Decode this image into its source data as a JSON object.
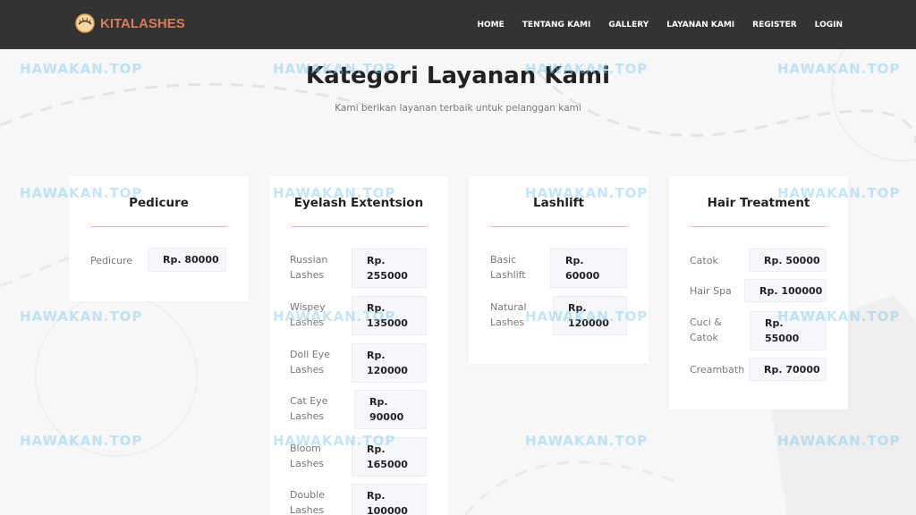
{
  "brand": {
    "name": "KITALASHES"
  },
  "nav": {
    "items": [
      "HOME",
      "TENTANG KAMI",
      "GALLERY",
      "LAYANAN KAMI",
      "REGISTER",
      "LOGIN"
    ]
  },
  "header": {
    "title": "Kategori Layanan Kami",
    "subtitle": "Kami berikan layanan terbaik untuk pelanggan kami"
  },
  "categories": [
    {
      "title": "Pedicure",
      "services": [
        {
          "name": "Pedicure",
          "price": "Rp. 80000"
        }
      ]
    },
    {
      "title": "Eyelash Extentsion",
      "services": [
        {
          "name1": "Russian",
          "name2": "Lashes",
          "price1": "Rp.",
          "price2": "255000"
        },
        {
          "name1": "Wispey",
          "name2": "Lashes",
          "price1": "Rp.",
          "price2": "135000"
        },
        {
          "name1": "Doll Eye",
          "name2": "Lashes",
          "price1": "Rp.",
          "price2": "120000"
        },
        {
          "name1": "Cat Eye",
          "name2": "Lashes",
          "price1": "Rp.",
          "price2": "90000"
        },
        {
          "name1": "Bloom",
          "name2": "Lashes",
          "price1": "Rp.",
          "price2": "165000"
        },
        {
          "name1": "Double",
          "name2": "Lashes",
          "price1": "Rp.",
          "price2": "100000"
        }
      ]
    },
    {
      "title": "Lashlift",
      "services": [
        {
          "name1": "Basic",
          "name2": "Lashlift",
          "price1": "Rp.",
          "price2": "60000"
        },
        {
          "name1": "Natural",
          "name2": "Lashes",
          "price1": "Rp.",
          "price2": "120000"
        }
      ]
    },
    {
      "title": "Hair Treatment",
      "services": [
        {
          "name": "Catok",
          "price": "Rp. 50000"
        },
        {
          "name": "Hair Spa",
          "price": "Rp. 100000"
        },
        {
          "name1": "Cuci &",
          "name2": "Catok",
          "price1": "Rp.",
          "price2": "55000"
        },
        {
          "name": "Creambath",
          "price": "Rp. 70000"
        }
      ]
    }
  ],
  "watermark": {
    "text": "HAWAKAN.TOP"
  },
  "colors": {
    "navbar": "#333333",
    "brand": "#d87c55",
    "accent_line": "#f0c94b"
  }
}
